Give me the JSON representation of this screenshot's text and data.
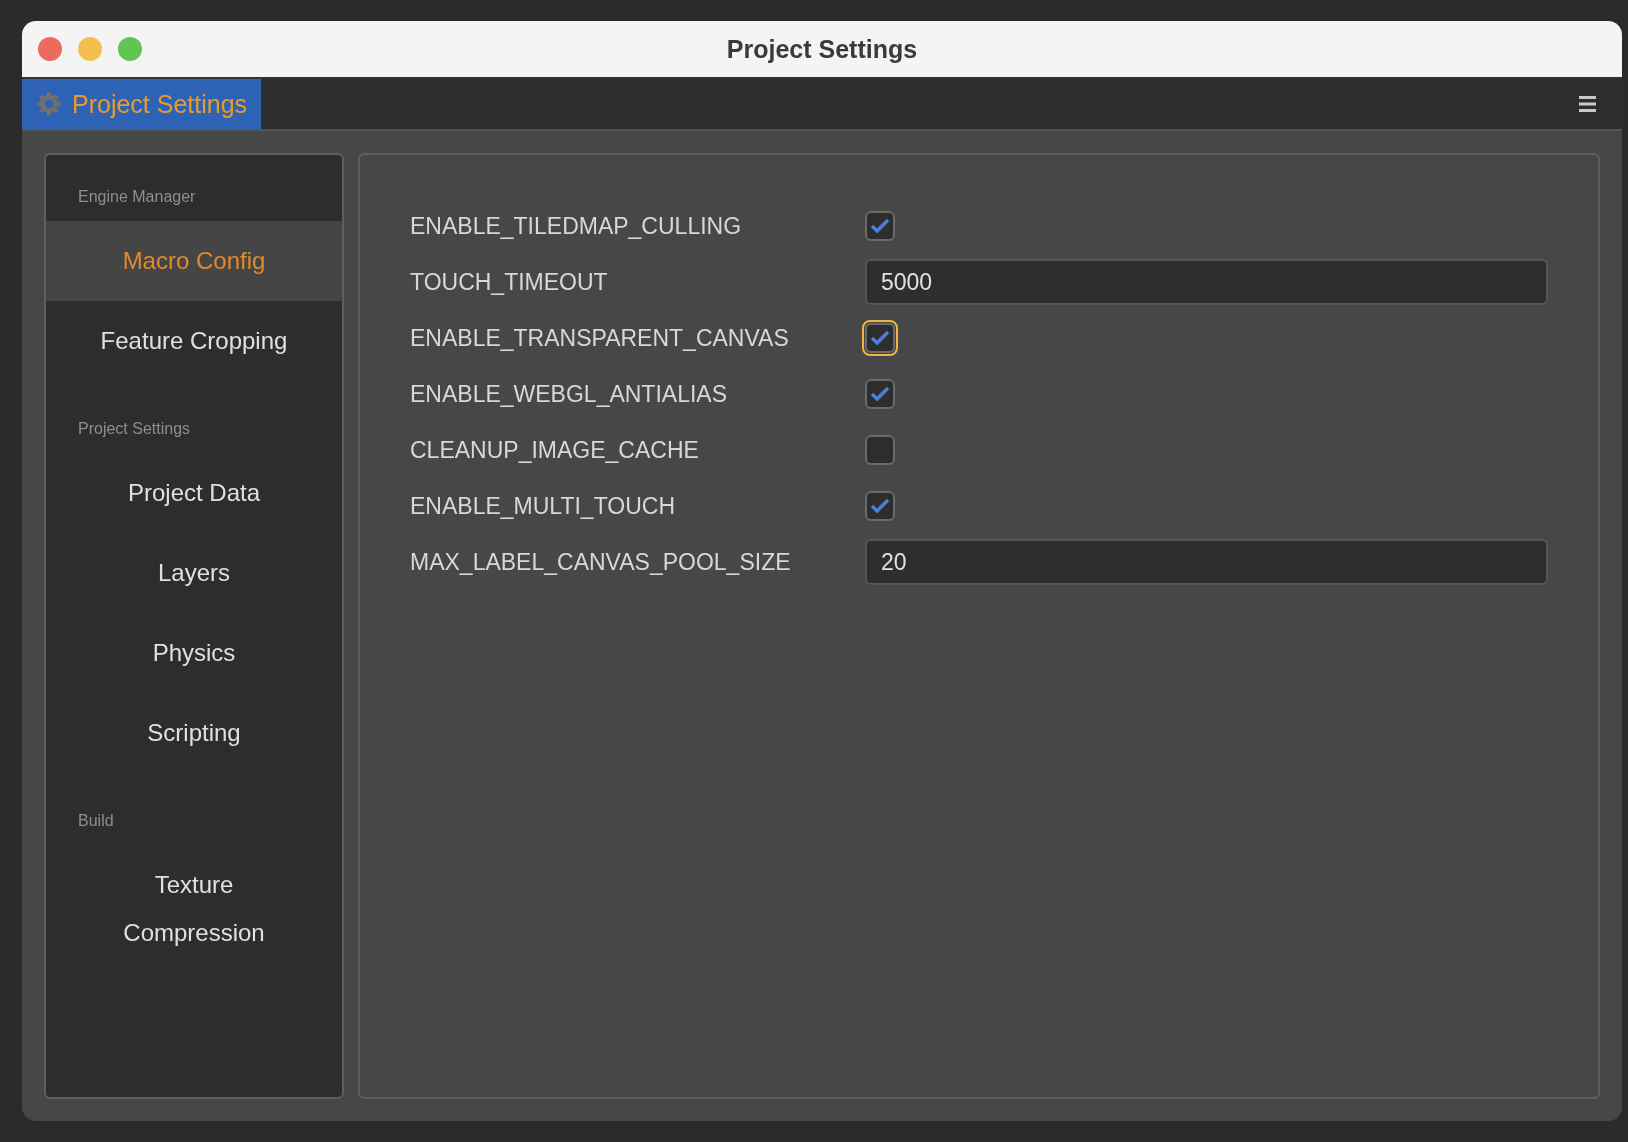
{
  "window": {
    "title": "Project Settings"
  },
  "tabs": [
    {
      "label": "Project Settings",
      "selected": true
    }
  ],
  "sidebar": {
    "sections": [
      {
        "header": "Engine Manager",
        "items": [
          {
            "label": "Macro Config",
            "selected": true
          },
          {
            "label": "Feature Cropping",
            "selected": false
          }
        ]
      },
      {
        "header": "Project Settings",
        "items": [
          {
            "label": "Project Data",
            "selected": false
          },
          {
            "label": "Layers",
            "selected": false
          },
          {
            "label": "Physics",
            "selected": false
          },
          {
            "label": "Scripting",
            "selected": false
          }
        ]
      },
      {
        "header": "Build",
        "items": [
          {
            "label": "Texture Compression",
            "selected": false
          }
        ]
      }
    ]
  },
  "settings": [
    {
      "name": "ENABLE_TILEDMAP_CULLING",
      "kind": "checkbox",
      "checked": true,
      "focused": false
    },
    {
      "name": "TOUCH_TIMEOUT",
      "kind": "input",
      "value": "5000"
    },
    {
      "name": "ENABLE_TRANSPARENT_CANVAS",
      "kind": "checkbox",
      "checked": true,
      "focused": true
    },
    {
      "name": "ENABLE_WEBGL_ANTIALIAS",
      "kind": "checkbox",
      "checked": true,
      "focused": false
    },
    {
      "name": "CLEANUP_IMAGE_CACHE",
      "kind": "checkbox",
      "checked": false,
      "focused": false
    },
    {
      "name": "ENABLE_MULTI_TOUCH",
      "kind": "checkbox",
      "checked": true,
      "focused": false
    },
    {
      "name": "MAX_LABEL_CANVAS_POOL_SIZE",
      "kind": "input",
      "value": "20"
    }
  ]
}
